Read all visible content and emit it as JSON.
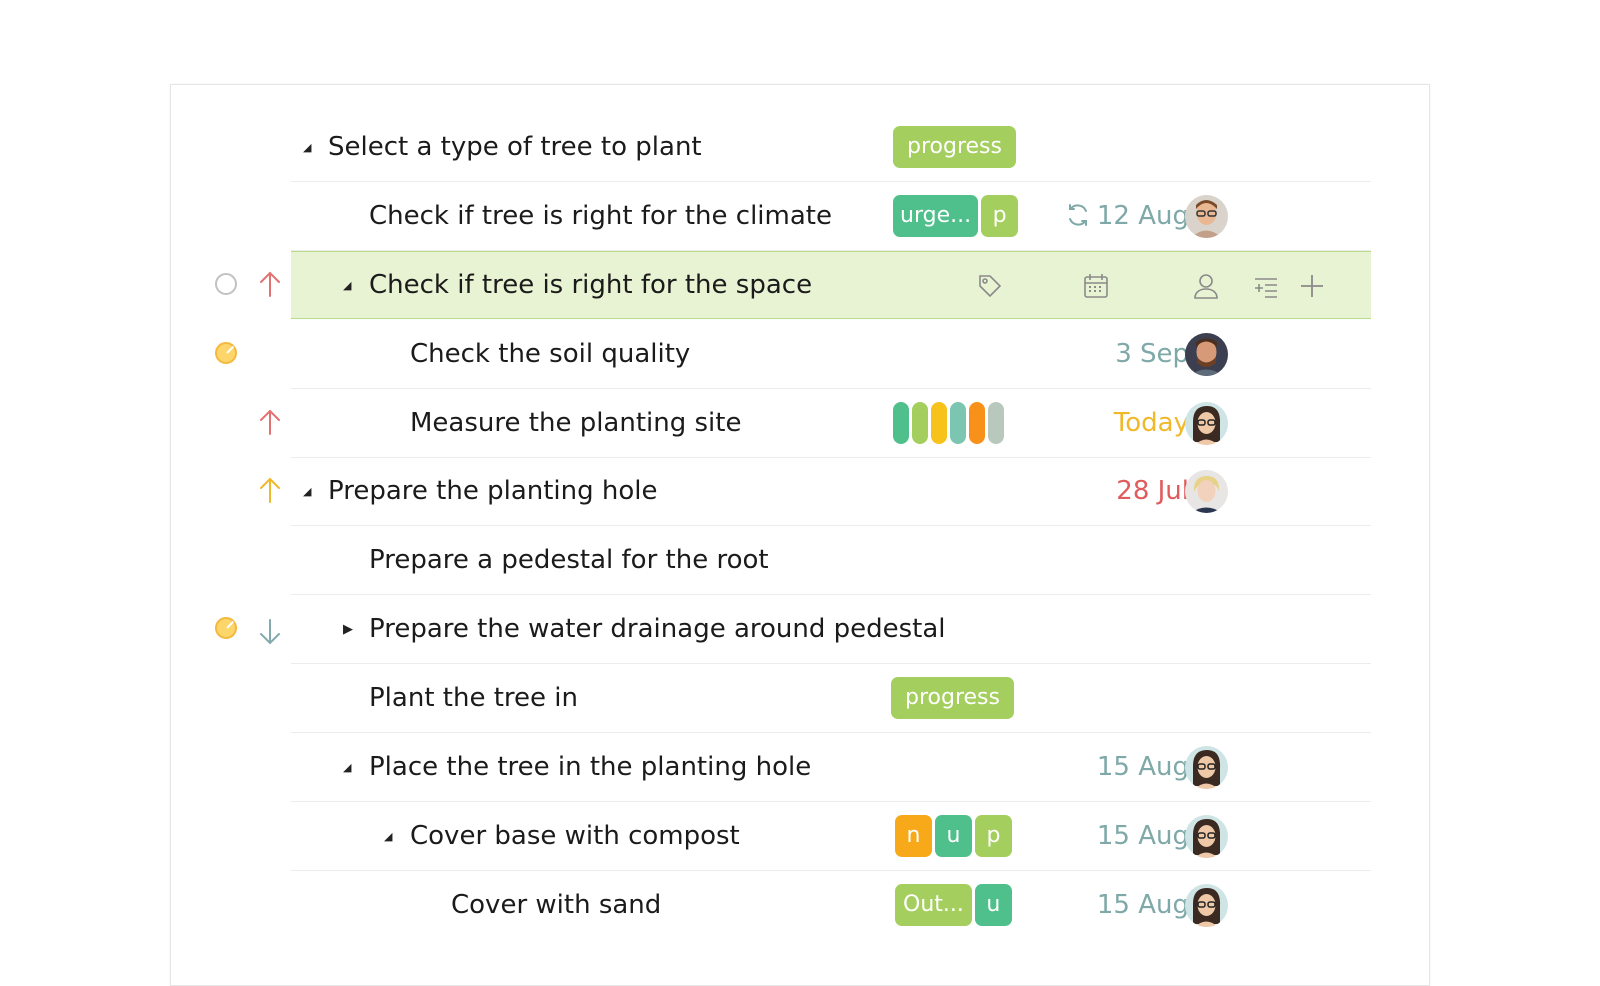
{
  "colors": {
    "progress": "#a4cf5e",
    "urgent": "#4fbf8c",
    "orange": "#f7a91a",
    "date_default": "#7fa8a8",
    "date_today": "#f0b92b",
    "date_overdue": "#e05b5b",
    "priority_high": "#e37171",
    "priority_medium": "#f0b92b",
    "priority_low": "#82a9ab"
  },
  "rows": [
    {
      "title": "Select a type of tree to plant",
      "tags": [
        "progress"
      ]
    },
    {
      "title": "Check if tree is right for the climate",
      "tags": [
        "urge...",
        "p"
      ],
      "date": "12 Aug",
      "repeat_icon": "repeat-icon"
    },
    {
      "title": "Check if tree is right for the space",
      "hover_icons": [
        "tag-icon",
        "calendar-icon",
        "person-icon",
        "add-subtask-icon",
        "plus-icon"
      ]
    },
    {
      "title": "Check the soil quality",
      "date": "3 Sep"
    },
    {
      "title": "Measure the planting site",
      "date": "Today"
    },
    {
      "title": "Prepare the planting hole",
      "date": "28 Jul"
    },
    {
      "title": "Prepare a pedestal for the root"
    },
    {
      "title": "Prepare the water drainage around pedestal"
    },
    {
      "title": "Plant the tree in",
      "tags": [
        "progress"
      ]
    },
    {
      "title": "Place the tree in the planting hole",
      "date": "15 Aug"
    },
    {
      "title": "Cover base with compost",
      "tags": [
        "n",
        "u",
        "p"
      ],
      "date": "15 Aug"
    },
    {
      "title": "Cover with sand",
      "tags": [
        "Out...",
        "u"
      ],
      "date": "15 Aug"
    }
  ]
}
